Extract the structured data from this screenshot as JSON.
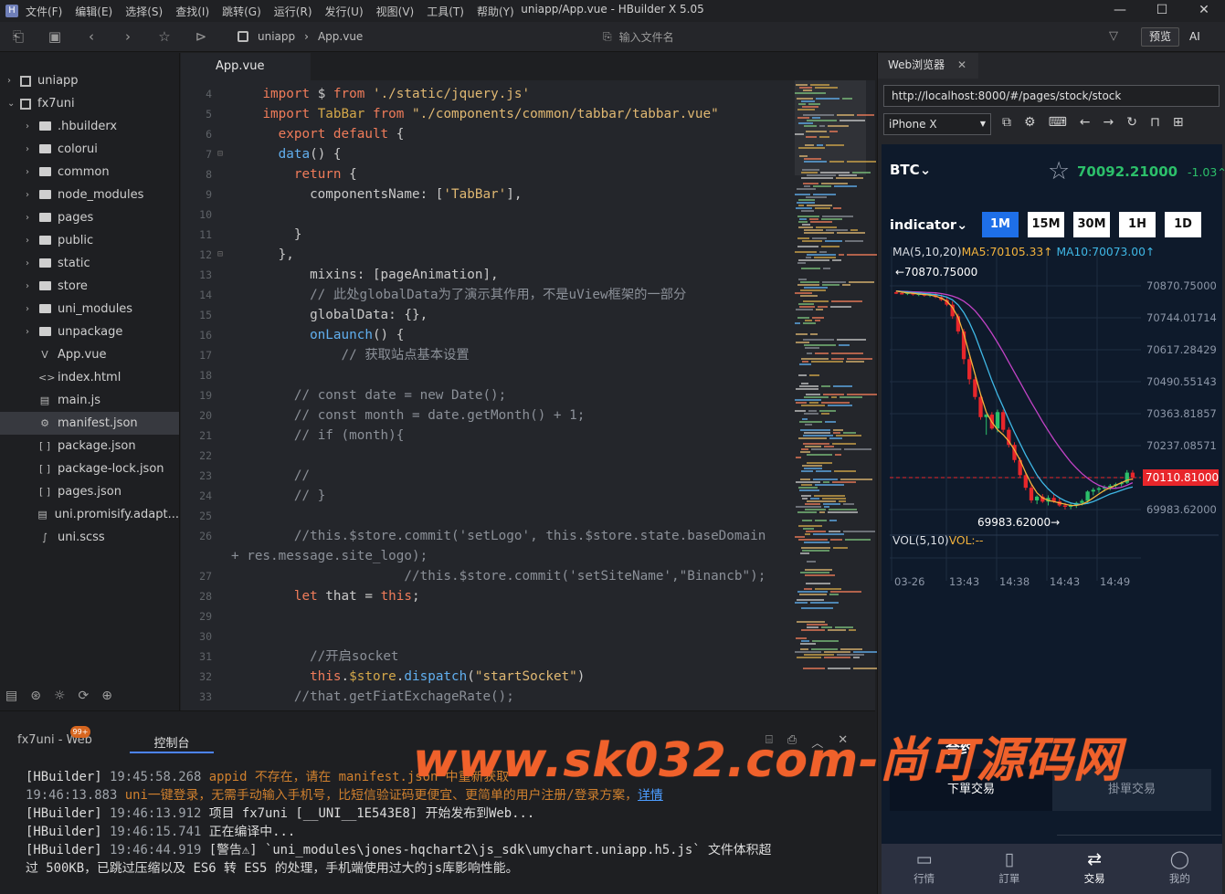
{
  "app": {
    "logo": "H",
    "window_title": "uniapp/App.vue - HBuilder X 5.05",
    "menu": [
      "文件(F)",
      "编辑(E)",
      "选择(S)",
      "查找(I)",
      "跳转(G)",
      "运行(R)",
      "发行(U)",
      "视图(V)",
      "工具(T)",
      "帮助(Y)"
    ],
    "win_buttons": [
      "—",
      "☐",
      "✕"
    ]
  },
  "toolbar": {
    "breadcrumb": [
      "uniapp",
      "App.vue"
    ],
    "file_input_placeholder": "输入文件名",
    "preview_label": "预览",
    "ai_label": "AI"
  },
  "sidebar": {
    "items": [
      {
        "label": "uniapp",
        "depth": 0,
        "arrow": "›",
        "icon": "project"
      },
      {
        "label": "fx7uni",
        "depth": 0,
        "arrow": "⌄",
        "icon": "project"
      },
      {
        "label": ".hbuilderx",
        "depth": 1,
        "arrow": "›",
        "icon": "folder"
      },
      {
        "label": "colorui",
        "depth": 1,
        "arrow": "›",
        "icon": "folder"
      },
      {
        "label": "common",
        "depth": 1,
        "arrow": "›",
        "icon": "folder"
      },
      {
        "label": "node_modules",
        "depth": 1,
        "arrow": "›",
        "icon": "folder"
      },
      {
        "label": "pages",
        "depth": 1,
        "arrow": "›",
        "icon": "folder"
      },
      {
        "label": "public",
        "depth": 1,
        "arrow": "›",
        "icon": "folder"
      },
      {
        "label": "static",
        "depth": 1,
        "arrow": "›",
        "icon": "folder"
      },
      {
        "label": "store",
        "depth": 1,
        "arrow": "›",
        "icon": "folder"
      },
      {
        "label": "uni_modules",
        "depth": 1,
        "arrow": "›",
        "icon": "folder"
      },
      {
        "label": "unpackage",
        "depth": 1,
        "arrow": "›",
        "icon": "folder"
      },
      {
        "label": "App.vue",
        "depth": 1,
        "arrow": "",
        "icon": "V"
      },
      {
        "label": "index.html",
        "depth": 1,
        "arrow": "",
        "icon": "<>"
      },
      {
        "label": "main.js",
        "depth": 1,
        "arrow": "",
        "icon": "▤"
      },
      {
        "label": "manifest.json",
        "depth": 1,
        "arrow": "",
        "icon": "⚙",
        "selected": true
      },
      {
        "label": "package.json",
        "depth": 1,
        "arrow": "",
        "icon": "[ ]"
      },
      {
        "label": "package-lock.json",
        "depth": 1,
        "arrow": "",
        "icon": "[ ]"
      },
      {
        "label": "pages.json",
        "depth": 1,
        "arrow": "",
        "icon": "[ ]"
      },
      {
        "label": "uni.promisify.adapt...",
        "depth": 1,
        "arrow": "",
        "icon": "▤"
      },
      {
        "label": "uni.scss",
        "depth": 1,
        "arrow": "",
        "icon": "∫"
      }
    ]
  },
  "editor": {
    "tab_label": "App.vue",
    "lines": [
      {
        "n": "4",
        "fold": "",
        "tokens": [
          [
            "    ",
            ""
          ],
          [
            "import",
            "kb"
          ],
          [
            " $ ",
            "id"
          ],
          [
            "from",
            "kb"
          ],
          [
            " ",
            ""
          ],
          [
            "'./static/jquery.js'",
            "st"
          ]
        ]
      },
      {
        "n": "5",
        "fold": "",
        "tokens": [
          [
            "    ",
            ""
          ],
          [
            "import",
            "kb"
          ],
          [
            " TabBar ",
            "kw"
          ],
          [
            "from",
            "kb"
          ],
          [
            " ",
            ""
          ],
          [
            "\"./components/common/tabbar/tabbar.vue\"",
            "st"
          ]
        ]
      },
      {
        "n": "6",
        "fold": "",
        "tokens": [
          [
            "      ",
            ""
          ],
          [
            "export default",
            "kb"
          ],
          [
            " {",
            "id"
          ]
        ]
      },
      {
        "n": "7",
        "fold": "⊟",
        "tokens": [
          [
            "      ",
            ""
          ],
          [
            "data",
            "fn"
          ],
          [
            "() {",
            "id"
          ]
        ]
      },
      {
        "n": "8",
        "fold": "",
        "tokens": [
          [
            "        ",
            ""
          ],
          [
            "return",
            "kb"
          ],
          [
            " {",
            "id"
          ]
        ]
      },
      {
        "n": "9",
        "fold": "",
        "tokens": [
          [
            "          ",
            ""
          ],
          [
            "componentsName: [",
            "id"
          ],
          [
            "'TabBar'",
            "st"
          ],
          [
            "],",
            "id"
          ]
        ]
      },
      {
        "n": "10",
        "fold": "",
        "tokens": []
      },
      {
        "n": "11",
        "fold": "",
        "tokens": [
          [
            "        ",
            ""
          ],
          [
            "}",
            "id"
          ]
        ]
      },
      {
        "n": "12",
        "fold": "⊟",
        "tokens": [
          [
            "      ",
            ""
          ],
          [
            "},",
            "id"
          ]
        ]
      },
      {
        "n": "13",
        "fold": "",
        "tokens": [
          [
            "          ",
            ""
          ],
          [
            "mixins: [pageAnimation],",
            "id"
          ]
        ]
      },
      {
        "n": "14",
        "fold": "",
        "tokens": [
          [
            "          ",
            ""
          ],
          [
            "// 此处globalData为了演示其作用，不是uView框架的一部分",
            "cm"
          ]
        ]
      },
      {
        "n": "15",
        "fold": "",
        "tokens": [
          [
            "          ",
            ""
          ],
          [
            "globalData: {},",
            "id"
          ]
        ]
      },
      {
        "n": "16",
        "fold": "",
        "tokens": [
          [
            "          ",
            ""
          ],
          [
            "onLaunch",
            "fn"
          ],
          [
            "() {",
            "id"
          ]
        ]
      },
      {
        "n": "17",
        "fold": "",
        "tokens": [
          [
            "              ",
            ""
          ],
          [
            "// 获取站点基本设置",
            "cm"
          ]
        ]
      },
      {
        "n": "18",
        "fold": "",
        "tokens": []
      },
      {
        "n": "19",
        "fold": "",
        "tokens": [
          [
            "        ",
            ""
          ],
          [
            "// const date = new Date();",
            "cm"
          ]
        ]
      },
      {
        "n": "20",
        "fold": "",
        "tokens": [
          [
            "        ",
            ""
          ],
          [
            "// const month = date.getMonth() + 1;",
            "cm"
          ]
        ]
      },
      {
        "n": "21",
        "fold": "",
        "tokens": [
          [
            "        ",
            ""
          ],
          [
            "// if (month){",
            "cm"
          ]
        ]
      },
      {
        "n": "22",
        "fold": "",
        "tokens": []
      },
      {
        "n": "23",
        "fold": "",
        "tokens": [
          [
            "        ",
            ""
          ],
          [
            "//",
            "cm"
          ]
        ]
      },
      {
        "n": "24",
        "fold": "",
        "tokens": [
          [
            "        ",
            ""
          ],
          [
            "// }",
            "cm"
          ]
        ]
      },
      {
        "n": "25",
        "fold": "",
        "tokens": []
      },
      {
        "n": "26",
        "fold": "",
        "tokens": [
          [
            "        ",
            ""
          ],
          [
            "//this.$store.commit('setLogo', this.$store.state.baseDomain",
            "cm"
          ]
        ]
      },
      {
        "n": "",
        "fold": "",
        "tokens": [
          [
            "+ res.message.site_logo);",
            "cm"
          ]
        ]
      },
      {
        "n": "27",
        "fold": "",
        "tokens": [
          [
            "                      ",
            ""
          ],
          [
            "//this.$store.commit('setSiteName',\"Binancb\");",
            "cm"
          ]
        ]
      },
      {
        "n": "28",
        "fold": "",
        "tokens": [
          [
            "        ",
            ""
          ],
          [
            "let",
            "kb"
          ],
          [
            " that = ",
            "id"
          ],
          [
            "this",
            "kb"
          ],
          [
            ";",
            "id"
          ]
        ]
      },
      {
        "n": "29",
        "fold": "",
        "tokens": []
      },
      {
        "n": "30",
        "fold": "",
        "tokens": []
      },
      {
        "n": "31",
        "fold": "",
        "tokens": [
          [
            "          ",
            ""
          ],
          [
            "//开启socket",
            "cm"
          ]
        ]
      },
      {
        "n": "32",
        "fold": "",
        "tokens": [
          [
            "          ",
            ""
          ],
          [
            "this",
            "kb"
          ],
          [
            ".",
            "id"
          ],
          [
            "$store",
            "kw"
          ],
          [
            ".",
            "id"
          ],
          [
            "dispatch",
            "fn"
          ],
          [
            "(",
            "id"
          ],
          [
            "\"startSocket\"",
            "st"
          ],
          [
            ")",
            "id"
          ]
        ]
      },
      {
        "n": "33",
        "fold": "",
        "tokens": [
          [
            "        ",
            ""
          ],
          [
            "//that.getFiatExchageRate();",
            "cm"
          ]
        ]
      }
    ]
  },
  "console": {
    "tab1_label": "fx7uni - Web",
    "tab1_badge": "99+",
    "tab2_label": "控制台",
    "logs": [
      [
        [
          "[HBuilder] ",
          "hb"
        ],
        [
          "19:45:58.268 ",
          "ts"
        ],
        [
          "appid 不存在，请在 manifest.json 中重新获取",
          "warn"
        ]
      ],
      [
        [
          "19:46:13.883 ",
          "ts"
        ],
        [
          "uni一键登录，无需手动输入手机号，比短信验证码更便宜、更简单的用户注册/登录方案，",
          "warn"
        ],
        [
          "详情",
          "lnk"
        ]
      ],
      [
        [
          "[HBuilder] ",
          "hb"
        ],
        [
          "19:46:13.912 ",
          "ts"
        ],
        [
          "项目 fx7uni [__UNI__1E543E8] 开始发布到Web...",
          "hb"
        ]
      ],
      [
        [
          "[HBuilder] ",
          "hb"
        ],
        [
          "19:46:15.741 ",
          "ts"
        ],
        [
          "正在编译中...",
          "hb"
        ]
      ],
      [
        [
          "[HBuilder] ",
          "hb"
        ],
        [
          "19:46:44.919 ",
          "ts"
        ],
        [
          "[警告⚠] `uni_modules\\jones-hqchart2\\js_sdk\\umychart.uniapp.h5.js` 文件体积超",
          "hb"
        ]
      ],
      [
        [
          "过 500KB，已跳过压缩以及 ES6 转 ES5 的处理，手机端使用过大的js库影响性能。",
          "hb"
        ]
      ]
    ]
  },
  "browser": {
    "tab_label": "Web浏览器",
    "url": "http://localhost:8000/#/pages/stock/stock",
    "device": "iPhone X",
    "phone": {
      "symbol": "BTC",
      "price": "70092.21000",
      "change": "-1.03",
      "indicator_label": "indicator",
      "periods": [
        {
          "label": "1M",
          "active": true
        },
        {
          "label": "15M",
          "active": false
        },
        {
          "label": "30M",
          "active": false
        },
        {
          "label": "1H",
          "active": false
        },
        {
          "label": "1D",
          "active": false
        }
      ],
      "ma_title": "MA(5,10,20)",
      "ma5_label": "MA5:70105.33↑",
      "ma10_label": "MA10:70073.00↑",
      "vol_title": "VOL(5,10)",
      "vol_label": "VOL:--",
      "high_label": "←70870.75000",
      "low_label": "69983.62000→",
      "current_label": "70110.81000",
      "trade_header": "合约",
      "trade_tabs": [
        "下單交易",
        "掛單交易"
      ],
      "nav": [
        {
          "label": "行情",
          "icon": "▭",
          "active": false
        },
        {
          "label": "訂單",
          "icon": "▯",
          "active": false
        },
        {
          "label": "交易",
          "icon": "⇄",
          "active": true
        },
        {
          "label": "我的",
          "icon": "◯",
          "active": false
        }
      ]
    }
  },
  "colors": {
    "up": "#2cbf6a",
    "down": "#e8262b",
    "ma5": "#f3b33d",
    "ma10": "#3fb8e6",
    "ma20": "#c243c6",
    "accent": "#1e6fe8",
    "watermark": "#f0612b"
  },
  "watermark": "www.sk032.com-尚可源码网",
  "chart_data": {
    "type": "candlestick",
    "y_ticks": [
      "70870.75000",
      "70744.01714",
      "70617.28429",
      "70490.55143",
      "70363.81857",
      "70237.08571",
      "70110.81000",
      "69983.62000"
    ],
    "ylim": [
      69983.62,
      70870.75
    ],
    "x_ticks": [
      "03-26",
      "13:43",
      "14:38",
      "14:43",
      "14:49"
    ],
    "candles": [
      {
        "o": 70845,
        "h": 70852,
        "l": 70838,
        "c": 70842
      },
      {
        "o": 70842,
        "h": 70849,
        "l": 70836,
        "c": 70840
      },
      {
        "o": 70840,
        "h": 70850,
        "l": 70834,
        "c": 70844
      },
      {
        "o": 70844,
        "h": 70848,
        "l": 70832,
        "c": 70836
      },
      {
        "o": 70836,
        "h": 70845,
        "l": 70830,
        "c": 70840
      },
      {
        "o": 70840,
        "h": 70846,
        "l": 70828,
        "c": 70832
      },
      {
        "o": 70832,
        "h": 70841,
        "l": 70826,
        "c": 70838
      },
      {
        "o": 70838,
        "h": 70843,
        "l": 70822,
        "c": 70826
      },
      {
        "o": 70826,
        "h": 70836,
        "l": 70810,
        "c": 70815
      },
      {
        "o": 70815,
        "h": 70826,
        "l": 70790,
        "c": 70796
      },
      {
        "o": 70796,
        "h": 70810,
        "l": 70740,
        "c": 70750
      },
      {
        "o": 70750,
        "h": 70760,
        "l": 70680,
        "c": 70690
      },
      {
        "o": 70690,
        "h": 70700,
        "l": 70560,
        "c": 70580
      },
      {
        "o": 70580,
        "h": 70590,
        "l": 70480,
        "c": 70500
      },
      {
        "o": 70500,
        "h": 70510,
        "l": 70420,
        "c": 70430
      },
      {
        "o": 70430,
        "h": 70440,
        "l": 70340,
        "c": 70350
      },
      {
        "o": 70350,
        "h": 70362,
        "l": 70280,
        "c": 70360
      },
      {
        "o": 70360,
        "h": 70370,
        "l": 70300,
        "c": 70305
      },
      {
        "o": 70305,
        "h": 70380,
        "l": 70290,
        "c": 70370
      },
      {
        "o": 70370,
        "h": 70380,
        "l": 70290,
        "c": 70300
      },
      {
        "o": 70300,
        "h": 70310,
        "l": 70230,
        "c": 70240
      },
      {
        "o": 70240,
        "h": 70250,
        "l": 70170,
        "c": 70180
      },
      {
        "o": 70180,
        "h": 70190,
        "l": 70110,
        "c": 70120
      },
      {
        "o": 70120,
        "h": 70130,
        "l": 70060,
        "c": 70070
      },
      {
        "o": 70070,
        "h": 70080,
        "l": 70010,
        "c": 70020
      },
      {
        "o": 70020,
        "h": 70040,
        "l": 70005,
        "c": 70035
      },
      {
        "o": 70035,
        "h": 70045,
        "l": 70010,
        "c": 70015
      },
      {
        "o": 70015,
        "h": 70040,
        "l": 70000,
        "c": 70030
      },
      {
        "o": 70030,
        "h": 70045,
        "l": 70010,
        "c": 70016
      },
      {
        "o": 70016,
        "h": 70030,
        "l": 69995,
        "c": 70000
      },
      {
        "o": 70000,
        "h": 70010,
        "l": 69984,
        "c": 69995
      },
      {
        "o": 69995,
        "h": 70008,
        "l": 69985,
        "c": 70000
      },
      {
        "o": 70000,
        "h": 70015,
        "l": 69990,
        "c": 70010
      },
      {
        "o": 70010,
        "h": 70025,
        "l": 70000,
        "c": 70018
      },
      {
        "o": 70018,
        "h": 70060,
        "l": 70010,
        "c": 70055
      },
      {
        "o": 70055,
        "h": 70070,
        "l": 70040,
        "c": 70062
      },
      {
        "o": 70062,
        "h": 70075,
        "l": 70050,
        "c": 70068
      },
      {
        "o": 70068,
        "h": 70080,
        "l": 70055,
        "c": 70072
      },
      {
        "o": 70072,
        "h": 70085,
        "l": 70060,
        "c": 70078
      },
      {
        "o": 70078,
        "h": 70090,
        "l": 70068,
        "c": 70084
      },
      {
        "o": 70084,
        "h": 70095,
        "l": 70075,
        "c": 70090
      },
      {
        "o": 70090,
        "h": 70140,
        "l": 70085,
        "c": 70130
      },
      {
        "o": 70130,
        "h": 70140,
        "l": 70100,
        "c": 70110
      }
    ],
    "ma5": [
      70850,
      70846,
      70843,
      70841,
      70838,
      70836,
      70834,
      70830,
      70822,
      70810,
      70785,
      70745,
      70680,
      70600,
      70520,
      70440,
      70370,
      70330,
      70300,
      70280,
      70255,
      70220,
      70180,
      70130,
      70085,
      70050,
      70030,
      70020,
      70015,
      70010,
      70005,
      70000,
      70000,
      70005,
      70015,
      70030,
      70045,
      70060,
      70070,
      70080,
      70090,
      70100,
      70105
    ],
    "ma10": [
      70850,
      70848,
      70846,
      70844,
      70842,
      70840,
      70838,
      70836,
      70832,
      70826,
      70815,
      70795,
      70765,
      70725,
      70675,
      70615,
      70555,
      70495,
      70440,
      70390,
      70340,
      70290,
      70245,
      70200,
      70160,
      70120,
      70090,
      70065,
      70045,
      70030,
      70018,
      70010,
      70005,
      70005,
      70008,
      70015,
      70025,
      70035,
      70045,
      70052,
      70060,
      70068,
      70073
    ],
    "ma20": [
      70850,
      70849,
      70848,
      70847,
      70846,
      70845,
      70844,
      70843,
      70840,
      70836,
      70830,
      70822,
      70810,
      70793,
      70772,
      70745,
      70715,
      70682,
      70646,
      70608,
      70568,
      70528,
      70488,
      70448,
      70408,
      70370,
      70332,
      70296,
      70262,
      70230,
      70200,
      70172,
      70148,
      70126,
      70108,
      70092,
      70080,
      70072,
      70068,
      70068,
      70072,
      70080,
      70090
    ]
  }
}
